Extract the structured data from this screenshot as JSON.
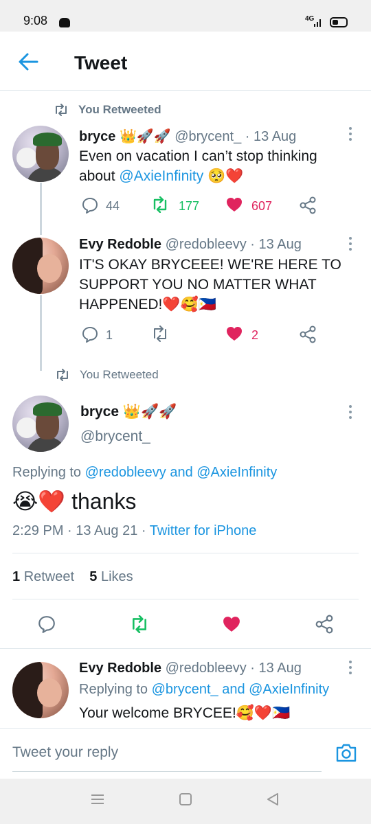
{
  "status_bar": {
    "time": "9:08",
    "network": "4G"
  },
  "header": {
    "title": "Tweet"
  },
  "retweet_label_1": "You Retweeted",
  "tweet1": {
    "name": "bryce",
    "emojis": "👑🚀🚀",
    "handle_date": "@brycent_ · 13 Aug",
    "text_prefix": "Even on vacation I can’t stop thinking about ",
    "mention": "@AxieInfinity",
    "text_suffix": " 🥺❤️",
    "replies": "44",
    "retweets": "177",
    "likes": "607"
  },
  "tweet2": {
    "name": "Evy Redoble",
    "handle_date": "@redobleevy · 13 Aug",
    "text": "IT'S OKAY BRYCEEE! WE'RE HERE TO SUPPORT YOU NO MATTER WHAT HAPPENED!❤️🥰🇵🇭",
    "replies": "1",
    "likes": "2"
  },
  "retweet_label_2": "You Retweeted",
  "main_tweet": {
    "name": "bryce",
    "emojis": "👑🚀🚀",
    "handle": "@brycent_",
    "replying_prefix": "Replying to ",
    "replying_mentions": "@redobleevy and @AxieInfinity",
    "text": "😭❤️ thanks",
    "meta_time": "2:29 PM · 13 Aug 21 · ",
    "meta_source": "Twitter for iPhone",
    "retweet_count": "1",
    "retweet_label": "Retweet",
    "like_count": "5",
    "like_label": "Likes"
  },
  "reply_tweet": {
    "name": "Evy Redoble",
    "handle_date": "@redobleevy · 13 Aug",
    "replying_prefix": "Replying to ",
    "replying_mentions": "@brycent_ and @AxieInfinity",
    "text": "Your welcome BRYCEE!🥰❤️🇵🇭"
  },
  "reply_box": {
    "placeholder": "Tweet your reply"
  },
  "colors": {
    "accent": "#1b95e0",
    "retweet_green": "#17bf63",
    "like_pink": "#e0245e",
    "muted": "#657786"
  }
}
